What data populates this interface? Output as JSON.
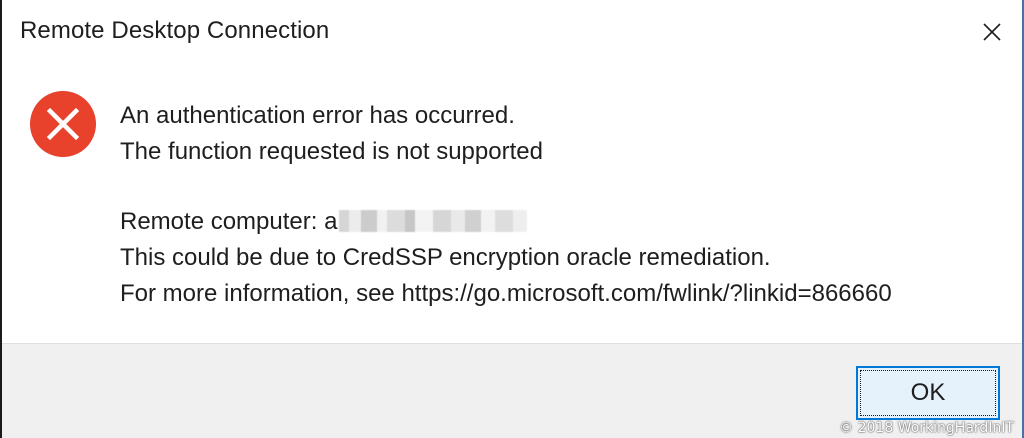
{
  "window": {
    "title": "Remote Desktop Connection",
    "close_icon": "close-icon"
  },
  "message": {
    "icon": "error-icon",
    "icon_color": "#e8412c",
    "line1": "An authentication error has occurred.",
    "line2": "The function requested is not supported",
    "remote_label": "Remote computer: a",
    "line4": "This could be due to CredSSP encryption oracle remediation.",
    "line5": "For more information, see https://go.microsoft.com/fwlink/?linkid=866660"
  },
  "buttons": {
    "ok_label": "OK"
  },
  "watermark": "© 2018 WorkingHardInIT",
  "colors": {
    "accent": "#0078d7",
    "button_bg": "#e5f1fb",
    "footer_bg": "#f0f0f0"
  }
}
